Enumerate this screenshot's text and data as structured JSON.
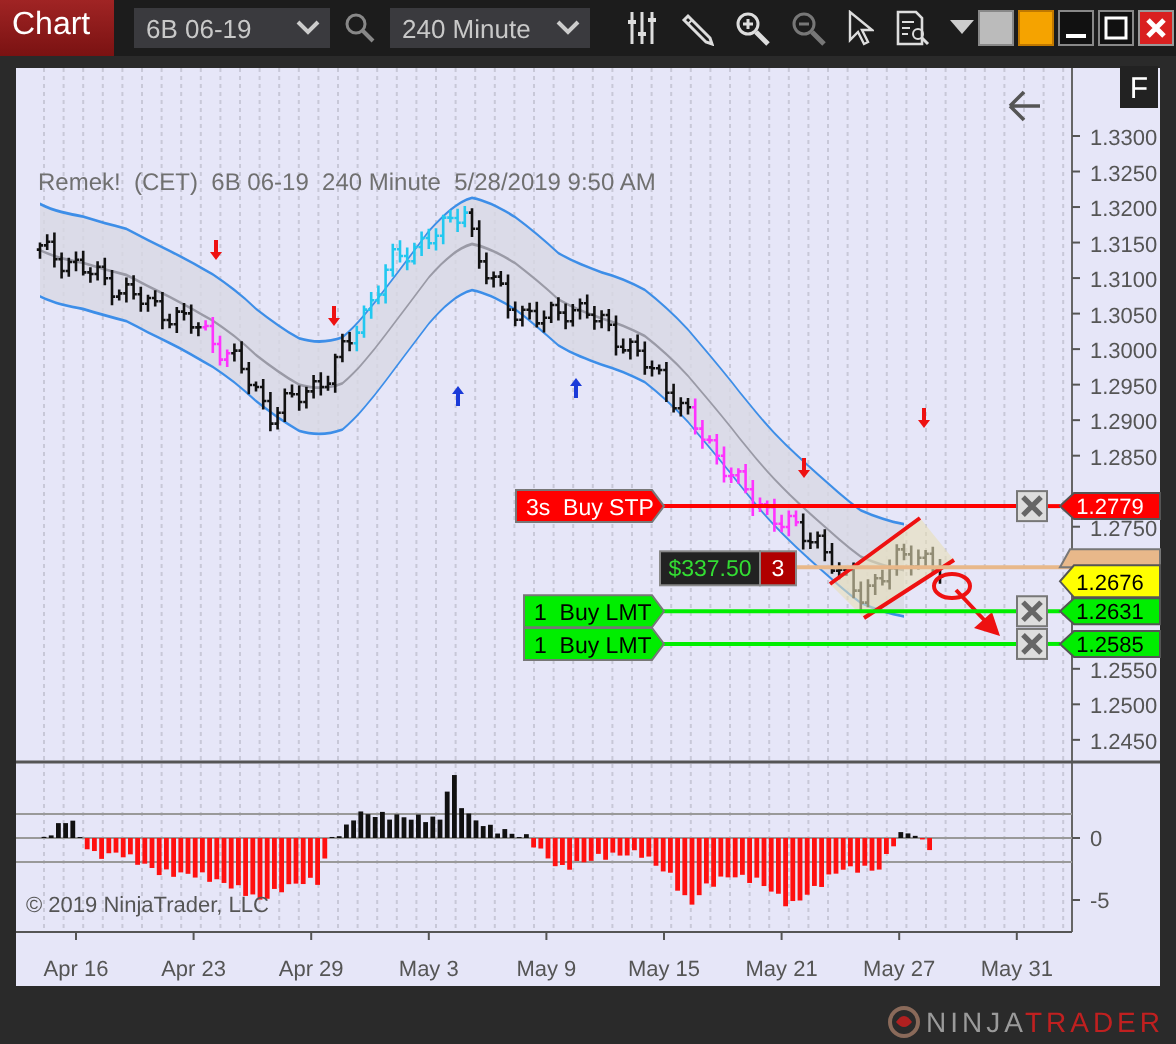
{
  "toolbar": {
    "title": "Chart",
    "instrument": "6B 06-19",
    "interval": "240 Minute"
  },
  "chart": {
    "header": "Remek!  (CET)  6B 06-19  240 Minute  5/28/2019 9:50 AM",
    "f_button": "F",
    "y_ticks": [
      "1.3300",
      "1.3250",
      "1.3200",
      "1.3150",
      "1.3100",
      "1.3050",
      "1.3000",
      "1.2950",
      "1.2900",
      "1.2850",
      "1.2750",
      "1.2550",
      "1.2500",
      "1.2450"
    ],
    "orders": [
      {
        "kind": "stop",
        "label": "3s  Buy STP",
        "price": "1.2779"
      },
      {
        "kind": "limit",
        "label": "1  Buy LMT",
        "price": "1.2631"
      },
      {
        "kind": "limit",
        "label": "1  Buy LMT",
        "price": "1.2585"
      }
    ],
    "position": {
      "pnl": "$337.50",
      "quantity": "3",
      "price": "1.2676"
    },
    "indicator": {
      "y_ticks": [
        "0",
        "-5"
      ]
    },
    "copyright": "© 2019 NinjaTrader, LLC",
    "x_ticks": [
      "Apr 16",
      "Apr 23",
      "Apr 29",
      "May 3",
      "May 9",
      "May 15",
      "May 21",
      "May 27",
      "May 31"
    ]
  },
  "logo": {
    "prefix": "NINJA",
    "suffix": "TRADER"
  }
}
